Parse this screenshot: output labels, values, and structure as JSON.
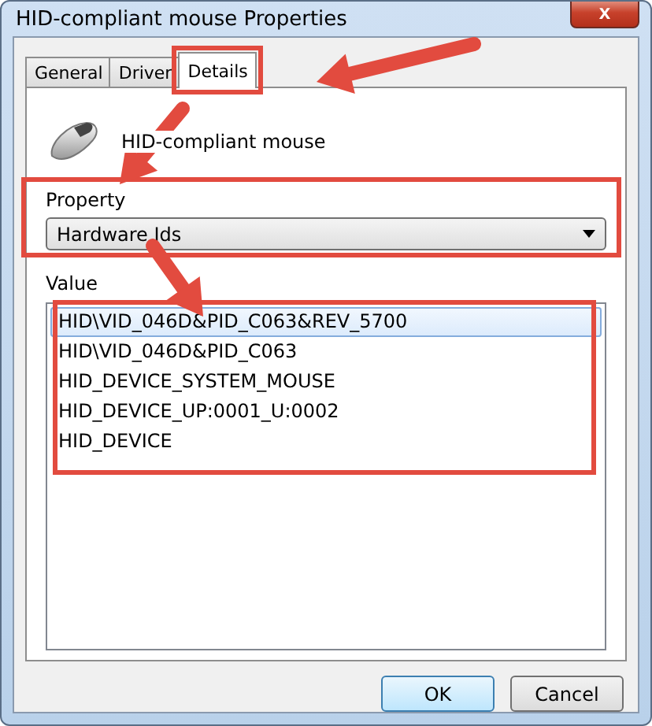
{
  "window": {
    "title": "HID-compliant mouse Properties",
    "close": "x"
  },
  "tabs": [
    {
      "label": "General",
      "selected": false
    },
    {
      "label": "Driver",
      "selected": false
    },
    {
      "label": "Details",
      "selected": true
    }
  ],
  "device": {
    "name": "HID-compliant mouse"
  },
  "property": {
    "label": "Property",
    "value": "Hardware Ids"
  },
  "values": {
    "label": "Value",
    "rows": [
      {
        "text": "HID\\VID_046D&PID_C063&REV_5700",
        "selected": true
      },
      {
        "text": "HID\\VID_046D&PID_C063",
        "selected": false
      },
      {
        "text": "HID_DEVICE_SYSTEM_MOUSE",
        "selected": false
      },
      {
        "text": "HID_DEVICE_UP:0001_U:0002",
        "selected": false
      },
      {
        "text": "HID_DEVICE",
        "selected": false
      }
    ]
  },
  "buttons": [
    {
      "label": "OK",
      "default": true
    },
    {
      "label": "Cancel",
      "default": false
    }
  ]
}
